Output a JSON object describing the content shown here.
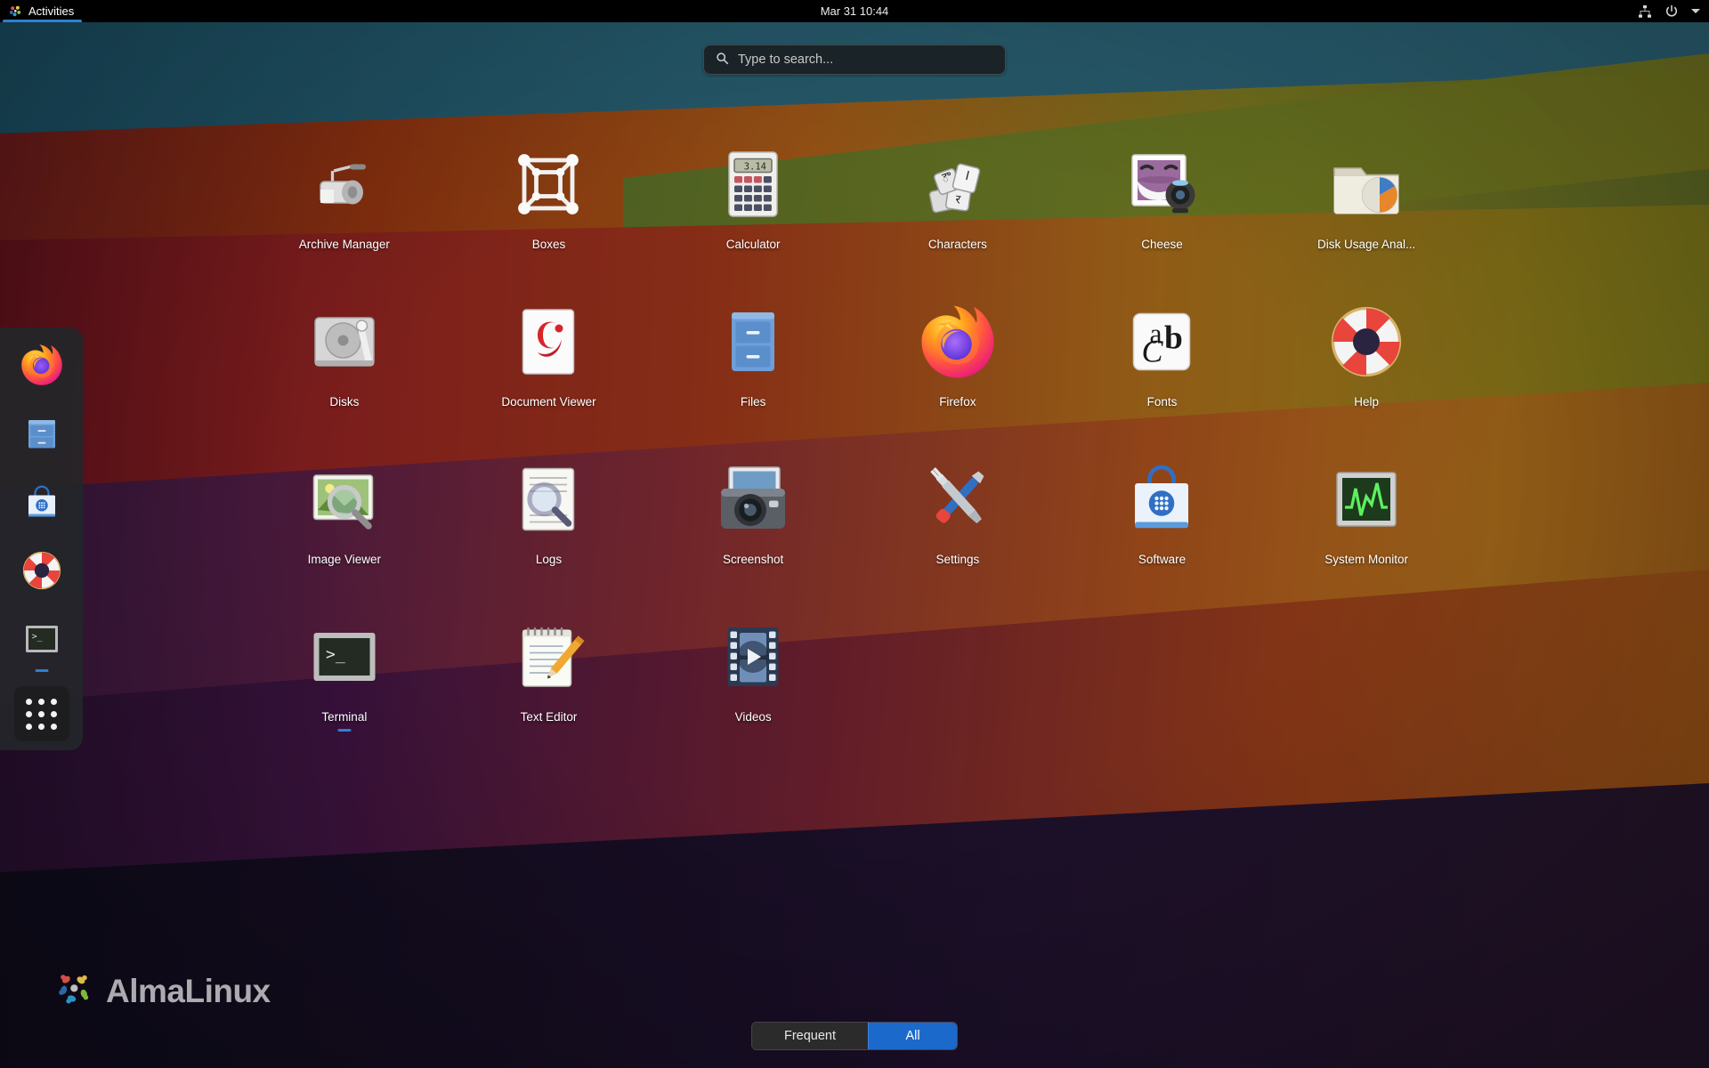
{
  "topbar": {
    "activities_label": "Activities",
    "clock": "Mar 31  10:44",
    "tray": {
      "network_icon": "network-wired-icon",
      "power_icon": "power-icon",
      "menu_icon": "chevron-down-icon"
    }
  },
  "search": {
    "placeholder": "Type to search...",
    "value": "",
    "icon": "search-icon"
  },
  "dock": {
    "items": [
      {
        "name": "Firefox",
        "icon": "firefox-icon",
        "running": false
      },
      {
        "name": "Files",
        "icon": "files-cabinet-icon",
        "running": false
      },
      {
        "name": "Software",
        "icon": "software-bag-icon",
        "running": false
      },
      {
        "name": "Help",
        "icon": "help-lifebuoy-icon",
        "running": false
      },
      {
        "name": "Terminal",
        "icon": "terminal-icon",
        "running": true
      }
    ],
    "show_apps_label": "Show Applications",
    "show_apps_icon": "grid-dots-icon"
  },
  "apps": [
    {
      "label": "Archive Manager",
      "icon": "archive-manager-icon",
      "running": false
    },
    {
      "label": "Boxes",
      "icon": "boxes-cube-icon",
      "running": false
    },
    {
      "label": "Calculator",
      "icon": "calculator-icon",
      "running": false
    },
    {
      "label": "Characters",
      "icon": "characters-keycaps-icon",
      "running": false
    },
    {
      "label": "Cheese",
      "icon": "cheese-webcam-icon",
      "running": false
    },
    {
      "label": "Disk Usage Anal...",
      "icon": "disk-usage-analyzer-icon",
      "running": false
    },
    {
      "label": "Disks",
      "icon": "disks-icon",
      "running": false
    },
    {
      "label": "Document Viewer",
      "icon": "document-viewer-icon",
      "running": false
    },
    {
      "label": "Files",
      "icon": "files-cabinet-icon",
      "running": false
    },
    {
      "label": "Firefox",
      "icon": "firefox-icon",
      "running": false
    },
    {
      "label": "Fonts",
      "icon": "fonts-icon",
      "running": false
    },
    {
      "label": "Help",
      "icon": "help-lifebuoy-icon",
      "running": false
    },
    {
      "label": "Image Viewer",
      "icon": "image-viewer-icon",
      "running": false
    },
    {
      "label": "Logs",
      "icon": "logs-icon",
      "running": false
    },
    {
      "label": "Screenshot",
      "icon": "screenshot-camera-icon",
      "running": false
    },
    {
      "label": "Settings",
      "icon": "settings-tools-icon",
      "running": false
    },
    {
      "label": "Software",
      "icon": "software-bag-icon",
      "running": false
    },
    {
      "label": "System Monitor",
      "icon": "system-monitor-icon",
      "running": false
    },
    {
      "label": "Terminal",
      "icon": "terminal-icon",
      "running": true
    },
    {
      "label": "Text Editor",
      "icon": "text-editor-icon",
      "running": false
    },
    {
      "label": "Videos",
      "icon": "videos-film-icon",
      "running": false
    }
  ],
  "view_toggle": {
    "frequent_label": "Frequent",
    "all_label": "All",
    "active": "All"
  },
  "watermark": {
    "text": "AlmaLinux",
    "icon": "almalinux-logo-icon"
  },
  "colors": {
    "accent_blue": "#1b6acb",
    "topbar_black": "#000000",
    "dock_bg": "#24262a",
    "label_white": "#ffffff"
  }
}
